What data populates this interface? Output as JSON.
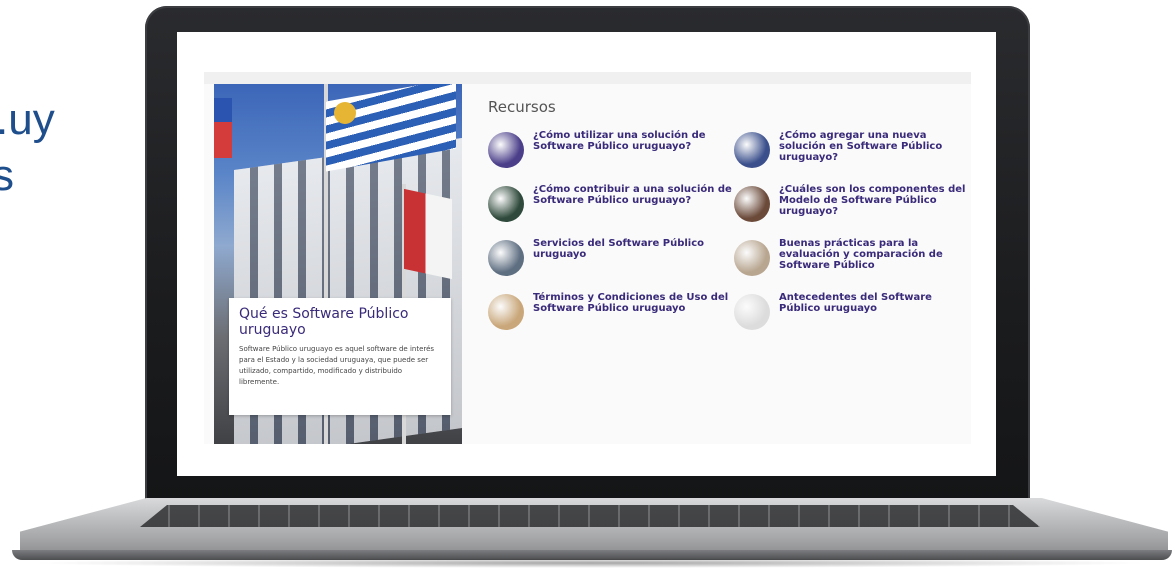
{
  "slide": {
    "text_line_1": ".uy",
    "text_line_2": "s"
  },
  "hero": {
    "title": "Qué es Software Público uruguayo",
    "description": "Software Público uruguayo es aquel software de interés para el Estado y la sociedad uruguaya, que puede ser utilizado, compartido, modificado y distribuido libremente."
  },
  "resources": {
    "heading": "Recursos",
    "items": [
      {
        "label": "¿Cómo utilizar una solución de Software Público uruguayo?",
        "icon": "person-laptop-icon",
        "color": "#4b3f8a"
      },
      {
        "label": "¿Cómo agregar una nueva solución en Software Público uruguayo?",
        "icon": "code-screen-icon",
        "color": "#3a4f8c"
      },
      {
        "label": "¿Cómo contribuir a una solución de Software Público uruguayo?",
        "icon": "keyboard-icon",
        "color": "#2f4a3c"
      },
      {
        "label": "¿Cuáles son los componentes del Modelo de Software Público uruguayo?",
        "icon": "hands-typing-icon",
        "color": "#6b4a3a"
      },
      {
        "label": "Servicios del Software Público uruguayo",
        "icon": "handshake-icon",
        "color": "#5f6f82"
      },
      {
        "label": "Buenas prácticas para la evaluación y comparación de Software Público",
        "icon": "meeting-icon",
        "color": "#b8a690"
      },
      {
        "label": "Términos y Condiciones de Uso del Software Público uruguayo",
        "icon": "document-icon",
        "color": "#c9a77a"
      },
      {
        "label": "Antecedentes del Software Público uruguayo",
        "icon": "paper-icon",
        "color": "#dcdcdc"
      }
    ]
  }
}
